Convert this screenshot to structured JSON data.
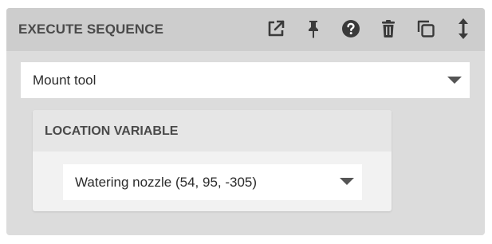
{
  "card": {
    "title": "EXECUTE SEQUENCE",
    "header_icons": [
      "external-link-icon",
      "pin-icon",
      "help-icon",
      "trash-icon",
      "duplicate-icon",
      "vertical-resize-icon"
    ]
  },
  "sequence_select": {
    "value": "Mount tool"
  },
  "location_variable": {
    "title": "LOCATION VARIABLE",
    "value": "Watering nozzle (54, 95, -305)"
  },
  "colors": {
    "card_background": "#dcdcdc",
    "header_background": "#cdcdcd",
    "icon_color": "#3a3a3a"
  }
}
